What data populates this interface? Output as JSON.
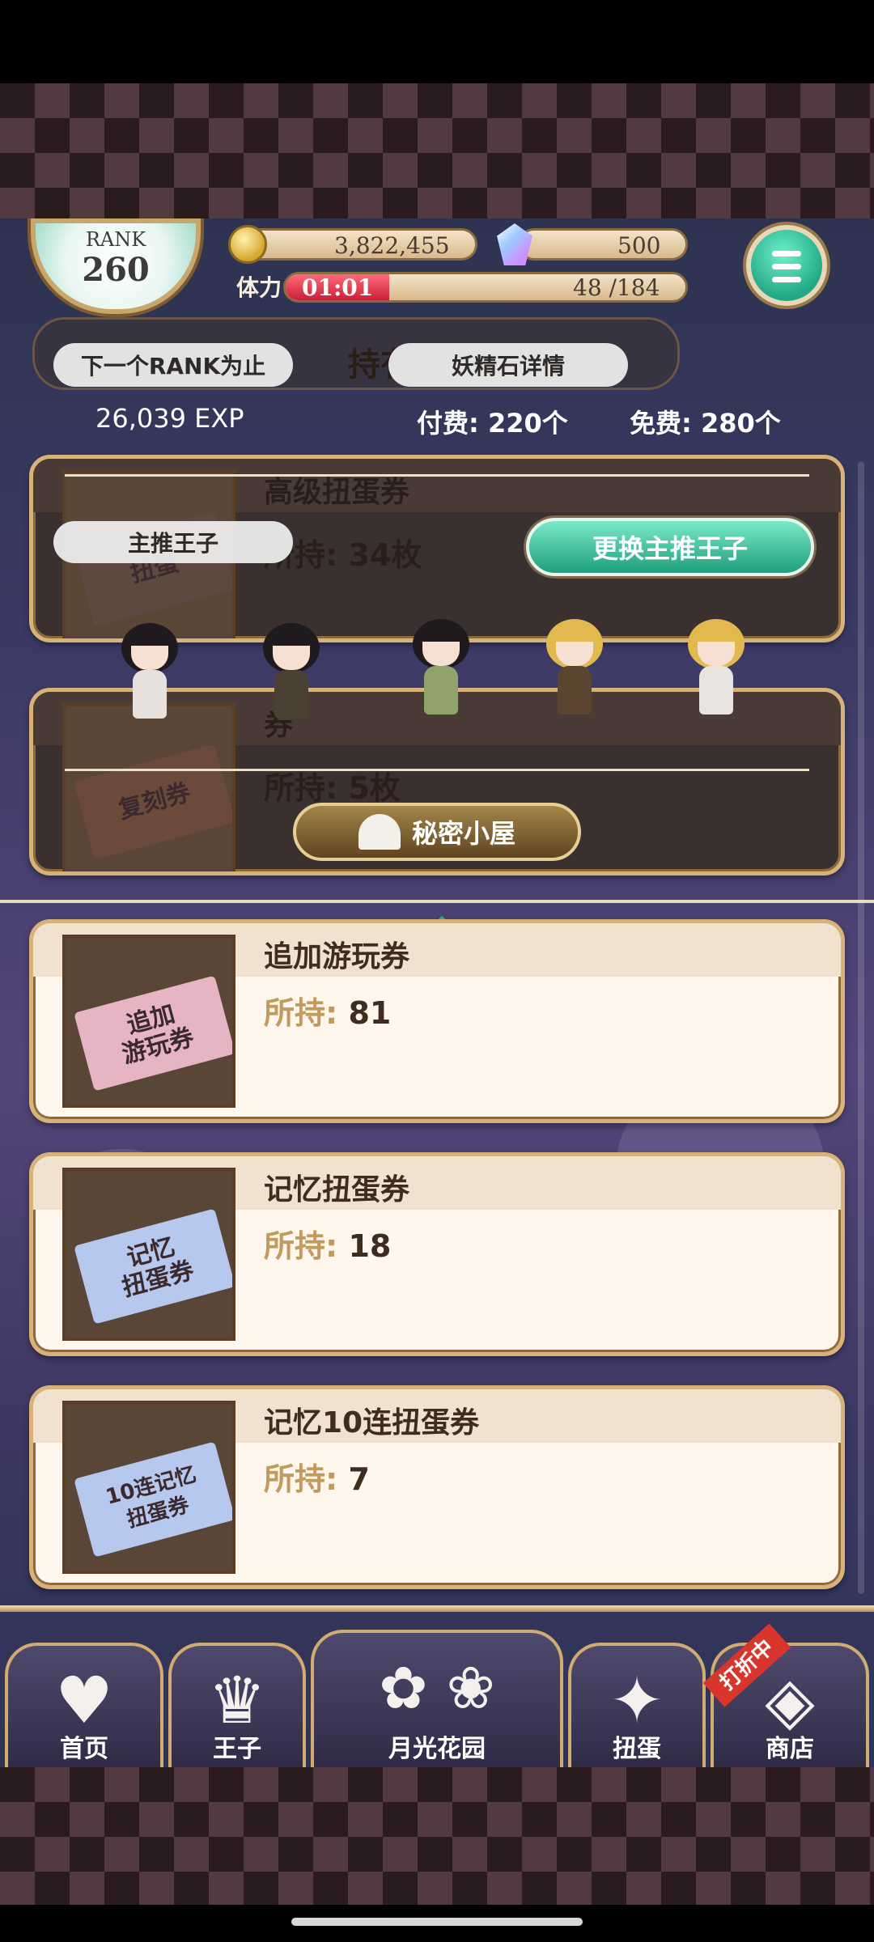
{
  "hud": {
    "rank_label": "RANK",
    "rank_value": "260",
    "coins": "3,822,455",
    "gems": "500",
    "stamina_label": "体力",
    "stamina_timer": "01:01",
    "stamina_value": "48 /184",
    "stamina_fraction": 0.26
  },
  "overlay": {
    "next_rank_pill": "下一个RANK为止",
    "gem_detail_pill": "妖精石详情",
    "hidden_header_text": "持有",
    "exp_text": "26,039 EXP",
    "paid_text": "付费: 220个",
    "free_text": "免费: 280个",
    "main_prince_pill": "主推王子",
    "change_prince_button": "更换主推王子",
    "secret_room_button": "秘密小屋"
  },
  "dimmed_items": [
    {
      "title": "高级扭蛋券",
      "count_label": "所持:",
      "count": "34枚",
      "ticket_text": "扭蛋"
    },
    {
      "title": "券",
      "count_label": "所持:",
      "count": "5枚",
      "ticket_text": "复刻券"
    }
  ],
  "items": [
    {
      "title": "追加游玩券",
      "count_label": "所持:",
      "count": "81",
      "ticket_text": "追加\n游玩券"
    },
    {
      "title": "记忆扭蛋券",
      "count_label": "所持:",
      "count": "18",
      "ticket_text": "记忆\n扭蛋券"
    },
    {
      "title": "记忆10连扭蛋券",
      "count_label": "所持:",
      "count": "7",
      "ticket_text": "10连记忆\n扭蛋券"
    }
  ],
  "nav": {
    "home": "首页",
    "prince": "王子",
    "garden": "月光花园",
    "gacha": "扭蛋",
    "shop": "商店",
    "sale_badge": "打折中"
  },
  "colors": {
    "accent_green": "#22a886",
    "gold": "#d9b27a",
    "stamina_red": "#e0304a"
  }
}
